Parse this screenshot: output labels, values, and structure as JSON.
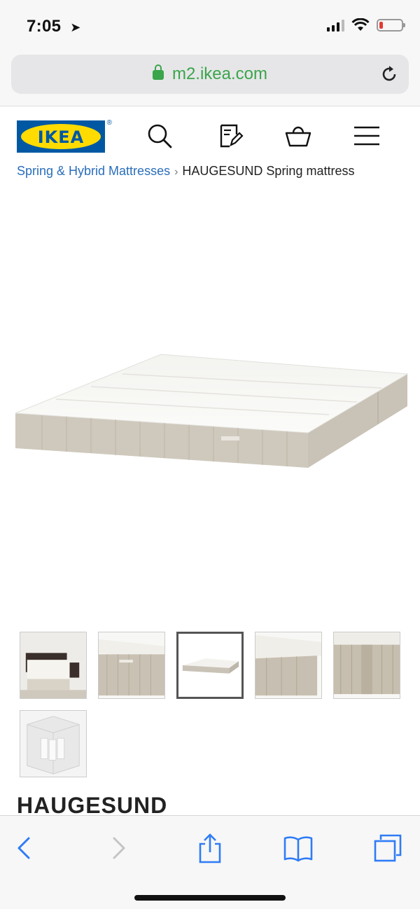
{
  "status_bar": {
    "time": "7:05",
    "location_icon": "location-arrow-icon",
    "battery_color": "#e53935"
  },
  "browser": {
    "url": "m2.ikea.com",
    "secure": true,
    "accent_color": "#3aa54b"
  },
  "header": {
    "logo_text": "IKEA",
    "logo_registered": "®",
    "icons": [
      "search-icon",
      "shopping-list-icon",
      "basket-icon",
      "menu-icon"
    ]
  },
  "breadcrumb": {
    "parent_label": "Spring & Hybrid Mattresses",
    "separator": "›",
    "current_label": "HAUGESUND Spring mattress",
    "link_color": "#2a6ebb"
  },
  "gallery": {
    "selected_index": 2,
    "thumbnails": [
      "bedroom",
      "side-corner",
      "full-mattress",
      "corner-closeup",
      "side-closeup",
      "packaged"
    ]
  },
  "product": {
    "name": "HAUGESUND"
  },
  "toolbar": {
    "icons": [
      "back-icon",
      "forward-icon",
      "share-icon",
      "bookmarks-icon",
      "tabs-icon"
    ],
    "accent_color": "#2f7cf6"
  }
}
